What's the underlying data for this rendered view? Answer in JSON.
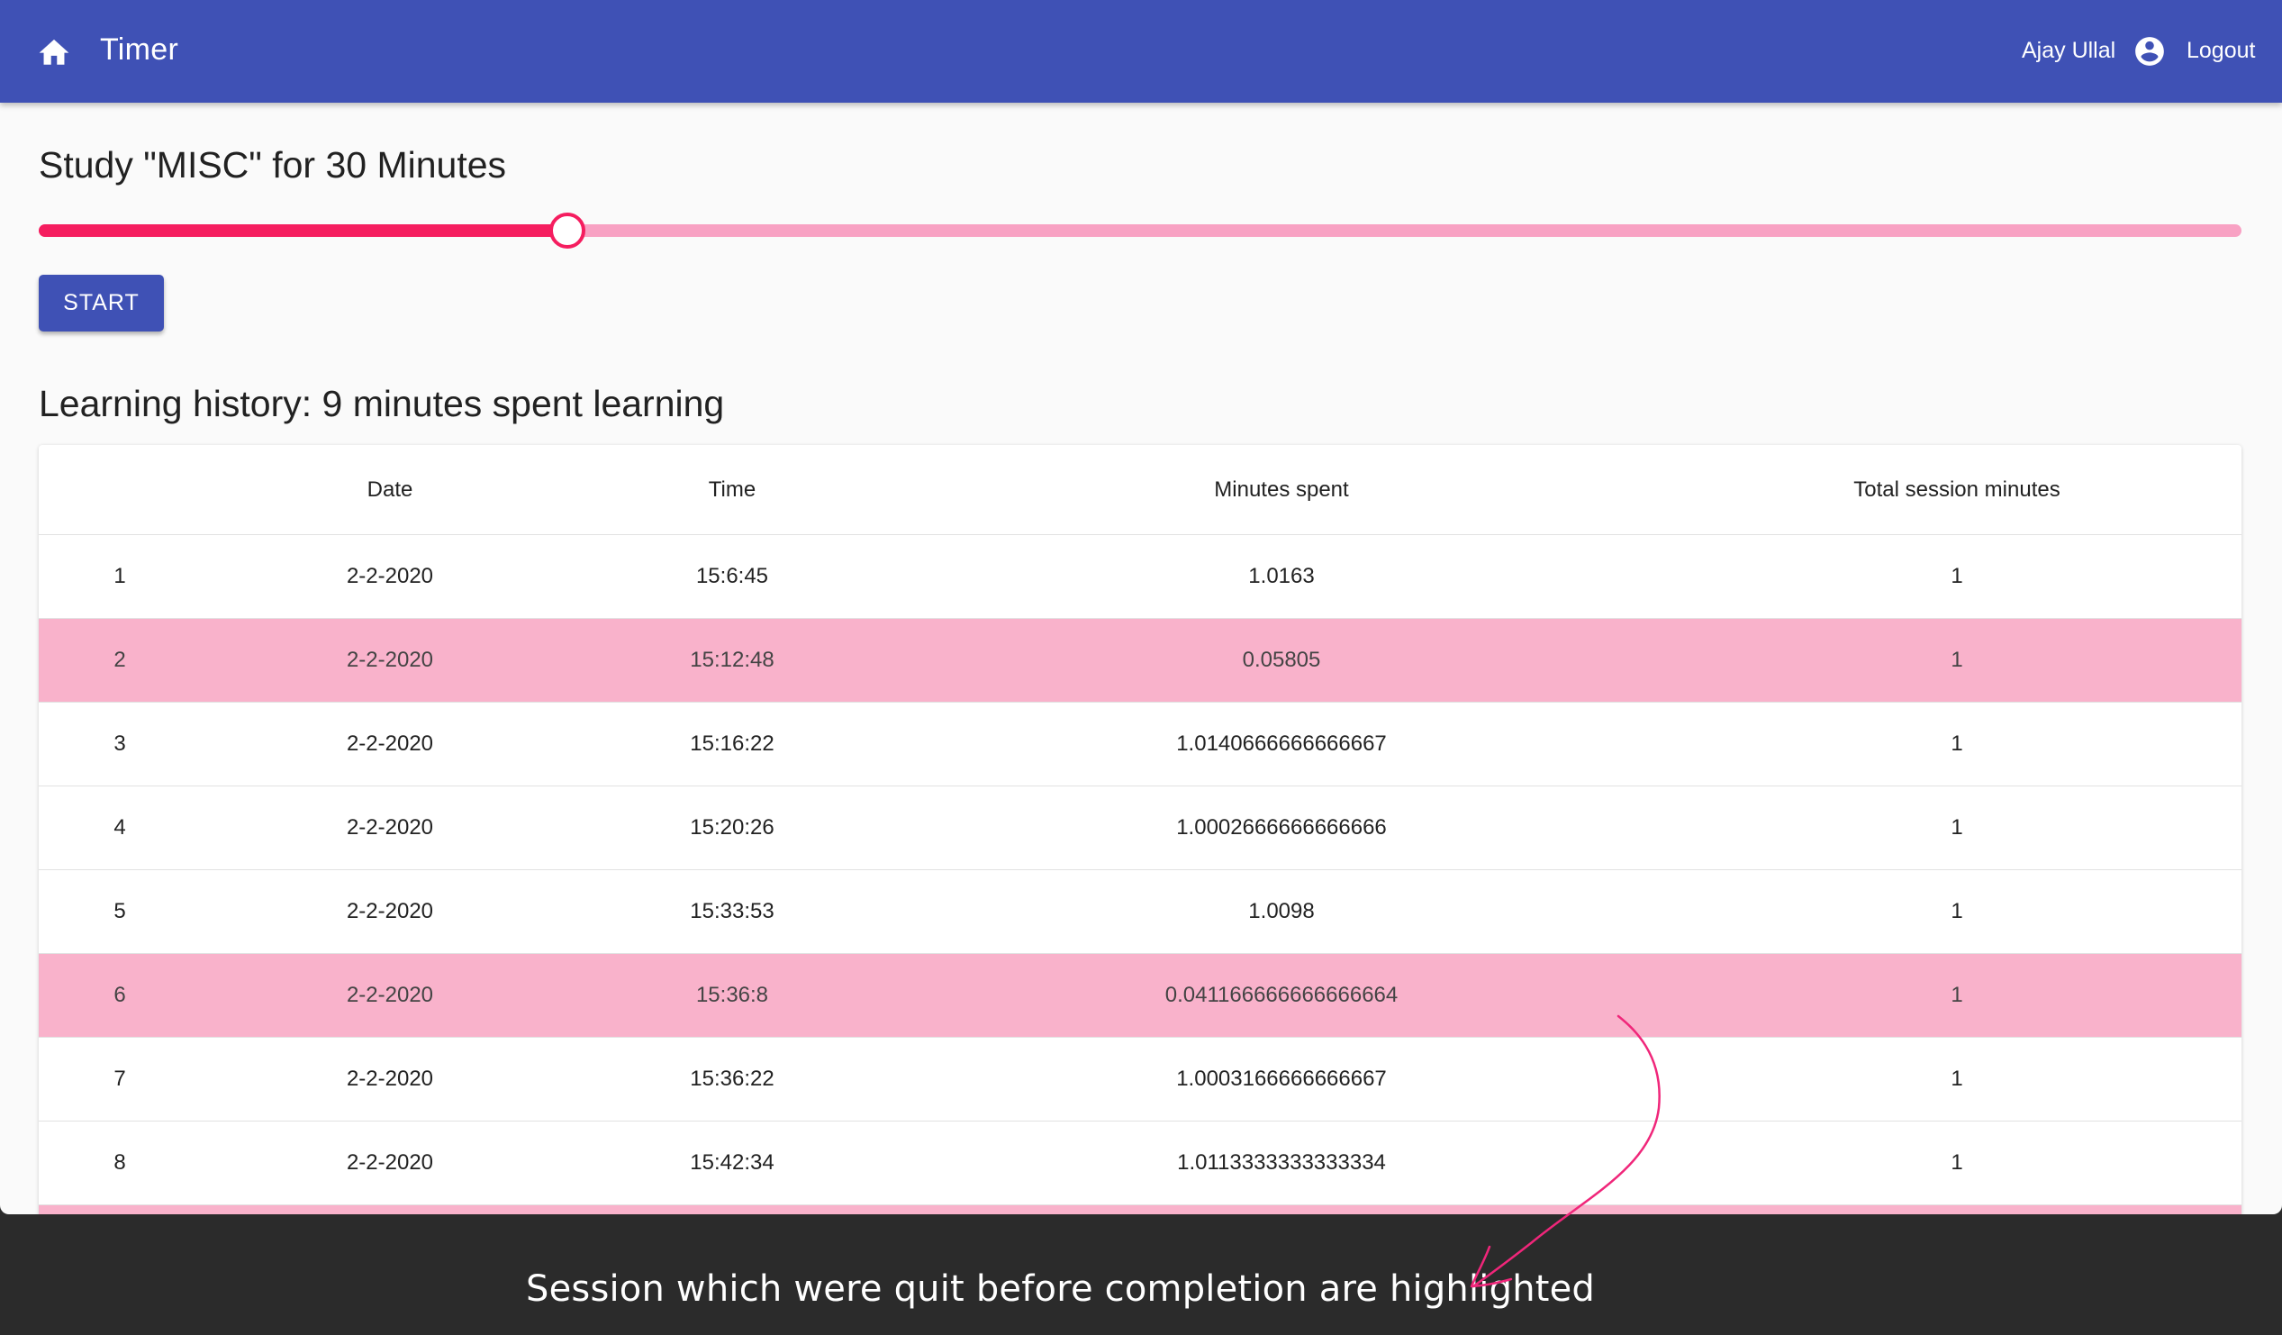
{
  "appbar": {
    "title": "Timer",
    "user_name": "Ajay Ullal",
    "logout_label": "Logout",
    "home_icon": "home-icon",
    "account_icon": "account-circle-icon",
    "color": "#3f51b5"
  },
  "study": {
    "heading": "Study \"MISC\" for 30 Minutes",
    "slider_value_fraction": 0.24,
    "slider_color": "#f51d5f",
    "start_label": "START"
  },
  "history": {
    "heading": "Learning history: 9 minutes spent learning",
    "columns": [
      "",
      "Date",
      "Time",
      "Minutes spent",
      "Total session minutes"
    ],
    "highlight_color": "#f9b2cb",
    "rows": [
      {
        "index": "1",
        "date": "2-2-2020",
        "time": "15:6:45",
        "minutes": "1.0163",
        "total": "1",
        "highlighted": false
      },
      {
        "index": "2",
        "date": "2-2-2020",
        "time": "15:12:48",
        "minutes": "0.05805",
        "total": "1",
        "highlighted": true
      },
      {
        "index": "3",
        "date": "2-2-2020",
        "time": "15:16:22",
        "minutes": "1.0140666666666667",
        "total": "1",
        "highlighted": false
      },
      {
        "index": "4",
        "date": "2-2-2020",
        "time": "15:20:26",
        "minutes": "1.0002666666666666",
        "total": "1",
        "highlighted": false
      },
      {
        "index": "5",
        "date": "2-2-2020",
        "time": "15:33:53",
        "minutes": "1.0098",
        "total": "1",
        "highlighted": false
      },
      {
        "index": "6",
        "date": "2-2-2020",
        "time": "15:36:8",
        "minutes": "0.041166666666666664",
        "total": "1",
        "highlighted": true
      },
      {
        "index": "7",
        "date": "2-2-2020",
        "time": "15:36:22",
        "minutes": "1.0003166666666667",
        "total": "1",
        "highlighted": false
      },
      {
        "index": "8",
        "date": "2-2-2020",
        "time": "15:42:34",
        "minutes": "1.0113333333333334",
        "total": "1",
        "highlighted": false
      },
      {
        "index": "",
        "date": "",
        "time": "",
        "minutes": "",
        "total": "",
        "highlighted": true
      }
    ]
  },
  "annotation": {
    "caption": "Session which were quit before completion are highlighted",
    "arrow_color": "#f0267a"
  }
}
